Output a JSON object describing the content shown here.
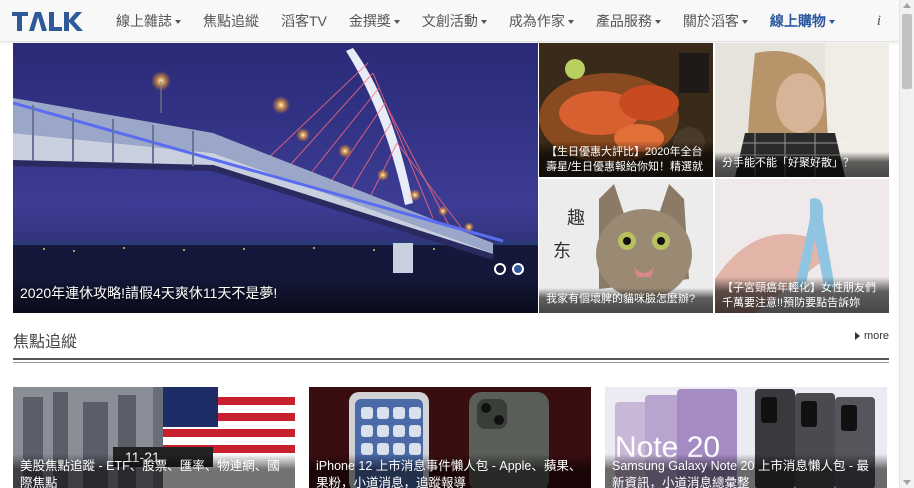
{
  "nav": {
    "logo": "TALK",
    "items": [
      {
        "label": "線上雜誌",
        "caret": true,
        "active": false
      },
      {
        "label": "焦點追縱",
        "caret": false,
        "active": false
      },
      {
        "label": "滔客TV",
        "caret": false,
        "active": false
      },
      {
        "label": "金撰獎",
        "caret": true,
        "active": false
      },
      {
        "label": "文創活動",
        "caret": true,
        "active": false
      },
      {
        "label": "成為作家",
        "caret": true,
        "active": false
      },
      {
        "label": "產品服務",
        "caret": true,
        "active": false
      },
      {
        "label": "關於滔客",
        "caret": true,
        "active": false
      },
      {
        "label": "線上購物",
        "caret": true,
        "active": true
      }
    ],
    "info": "i"
  },
  "hero": {
    "caption": "2020年連休攻略!請假4天爽休11天不是夢!",
    "slides": 2,
    "active_slide": 2
  },
  "tiles": [
    {
      "caption": "【生日優惠大評比】2020年全台壽星/生日優惠報給你知！精選就"
    },
    {
      "caption": "分手能不能「好聚好散」？"
    },
    {
      "caption": "我家有個壞脾的貓咪臉怎麼辦?"
    },
    {
      "caption": "【子宮頸癌年輕化】女性朋友們千萬要注意!!預防要點告訴妳"
    }
  ],
  "section": {
    "title": "焦點追縱",
    "more": "more"
  },
  "cards": [
    {
      "caption": "美股焦點追蹤 - ETF、股票、匯率、物連網、國際焦點"
    },
    {
      "caption": "iPhone 12 上市消息事件懶人包 - Apple、蘋果、果粉，小道消息，追蹤報導"
    },
    {
      "caption": "Samsung Galaxy Note 20 上市消息懶人包 - 最新資訊，小道消息總彙整"
    }
  ],
  "colors": {
    "accent": "#2e5a9e",
    "nav_bg": "#f8f8f8"
  }
}
